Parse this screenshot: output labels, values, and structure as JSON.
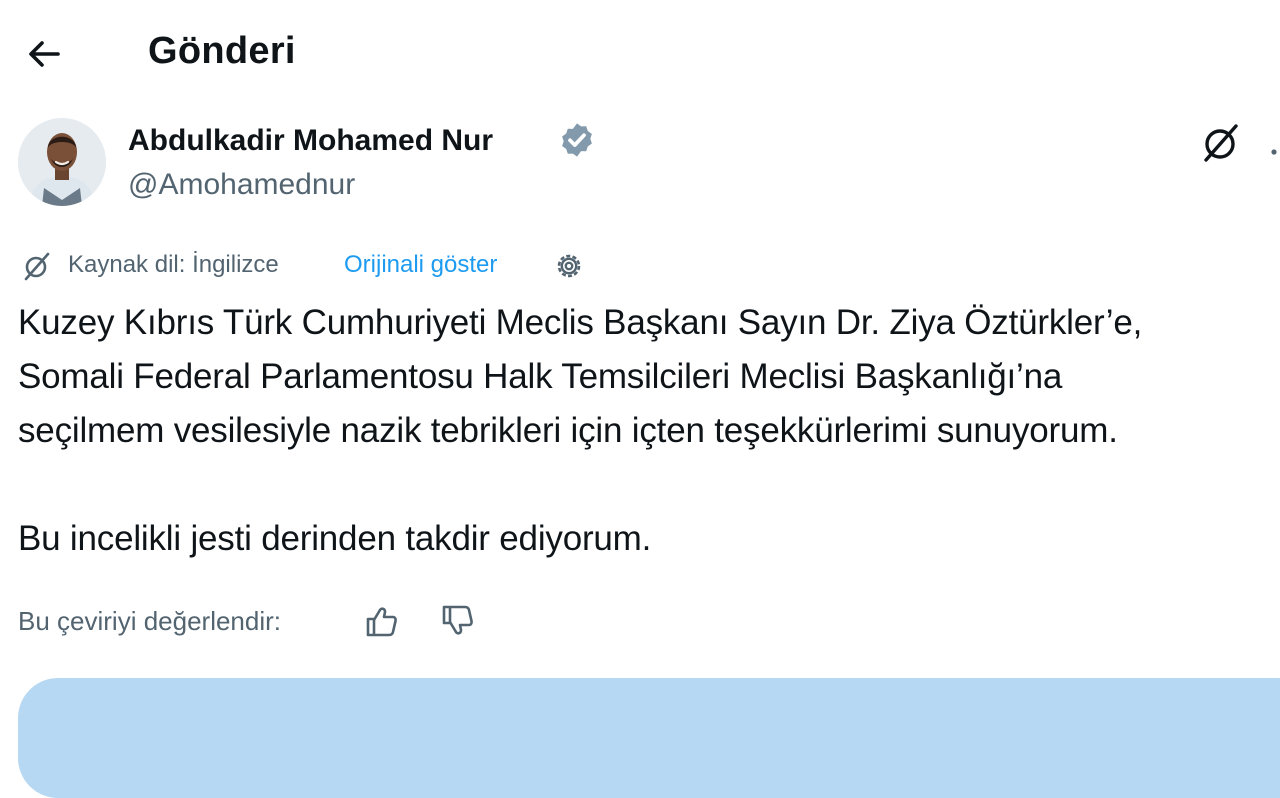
{
  "header": {
    "back_icon": "arrow-left-icon",
    "title": "Gönderi"
  },
  "author": {
    "name": "Abdulkadir Mohamed Nur",
    "handle": "@Amohamednur",
    "verified_icon": "verified-badge-icon",
    "verified_color": "#829aab",
    "grok_icon": "grok-slash-icon",
    "more_icon": "more-dots-icon"
  },
  "translation": {
    "icon": "grok-slash-icon",
    "source_label": "Kaynak dil: İngilizce",
    "show_original": "Orijinali göster",
    "settings_icon": "gear-icon",
    "link_color": "#1d9bf0"
  },
  "post": {
    "text": "Kuzey Kıbrıs Türk Cumhuriyeti Meclis Başkanı Sayın Dr. Ziya Öztürkler’e,\nSomali Federal Parlamentosu Halk Temsilcileri Meclisi Başkanlığı’na\nseçilmem vesilesiyle nazik tebrikleri için içten teşekkürlerimi sunuyorum.\n\nBu incelikli jesti derinden takdir ediyorum."
  },
  "rating": {
    "label": "Bu çeviriyi değerlendir:",
    "up_icon": "thumbs-up-icon",
    "down_icon": "thumbs-down-icon"
  },
  "colors": {
    "text": "#0f1419",
    "secondary": "#536471",
    "card": "#b7d8f2"
  }
}
